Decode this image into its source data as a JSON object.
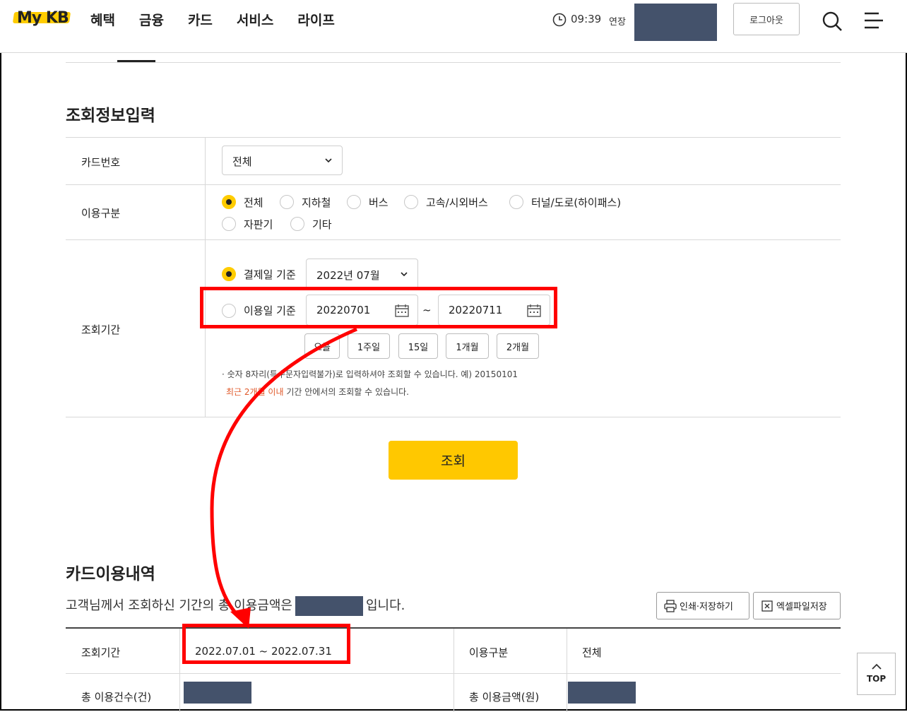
{
  "header": {
    "logo": "My KB",
    "nav": [
      "혜택",
      "금융",
      "카드",
      "서비스",
      "라이프"
    ],
    "time": "09:39",
    "extend_label": "연장",
    "logout_label": "로그아웃"
  },
  "search_section": {
    "title": "조회정보입력",
    "card_number_label": "카드번호",
    "card_number_value": "전체",
    "usage_type_label": "이용구분",
    "usage_types": [
      "전체",
      "지하철",
      "버스",
      "고속/시외버스",
      "터널/도로(하이패스)",
      "자판기",
      "기타"
    ],
    "usage_type_selected": "전체",
    "period_label": "조회기간",
    "payment_date_label": "결제일 기준",
    "payment_month_value": "2022년 07월",
    "usage_date_label": "이용일 기준",
    "start_date": "20220701",
    "date_separator": "~",
    "end_date": "20220711",
    "quick_buttons": [
      "오늘",
      "1주일",
      "15일",
      "1개월",
      "2개월"
    ],
    "note_line1": "· 숫자 8자리(특수문자입력불가)로 입력하셔야 조회할 수 있습니다. 예) 20150101",
    "note_line2_red": "최근 2개월 이내",
    "note_line2_rest": " 기간 안에서의 조회할 수 있습니다.",
    "search_button": "조회"
  },
  "results": {
    "title": "카드이용내역",
    "summary_prefix": "고객님께서 조회하신 기간의 총 이용금액은",
    "summary_suffix": "입니다.",
    "print_button": "인쇄·저장하기",
    "excel_button": "엑셀파일저장",
    "period_label": "조회기간",
    "period_value": "2022.07.01 ~ 2022.07.31",
    "usage_type_label": "이용구분",
    "usage_type_value": "전체",
    "total_count_label": "총 이용건수(건)",
    "total_amount_label": "총 이용금액(원)"
  },
  "top_button": "TOP",
  "colors": {
    "accent": "#ffcc00",
    "annotation": "#ff0000",
    "mask": "#44526b"
  }
}
